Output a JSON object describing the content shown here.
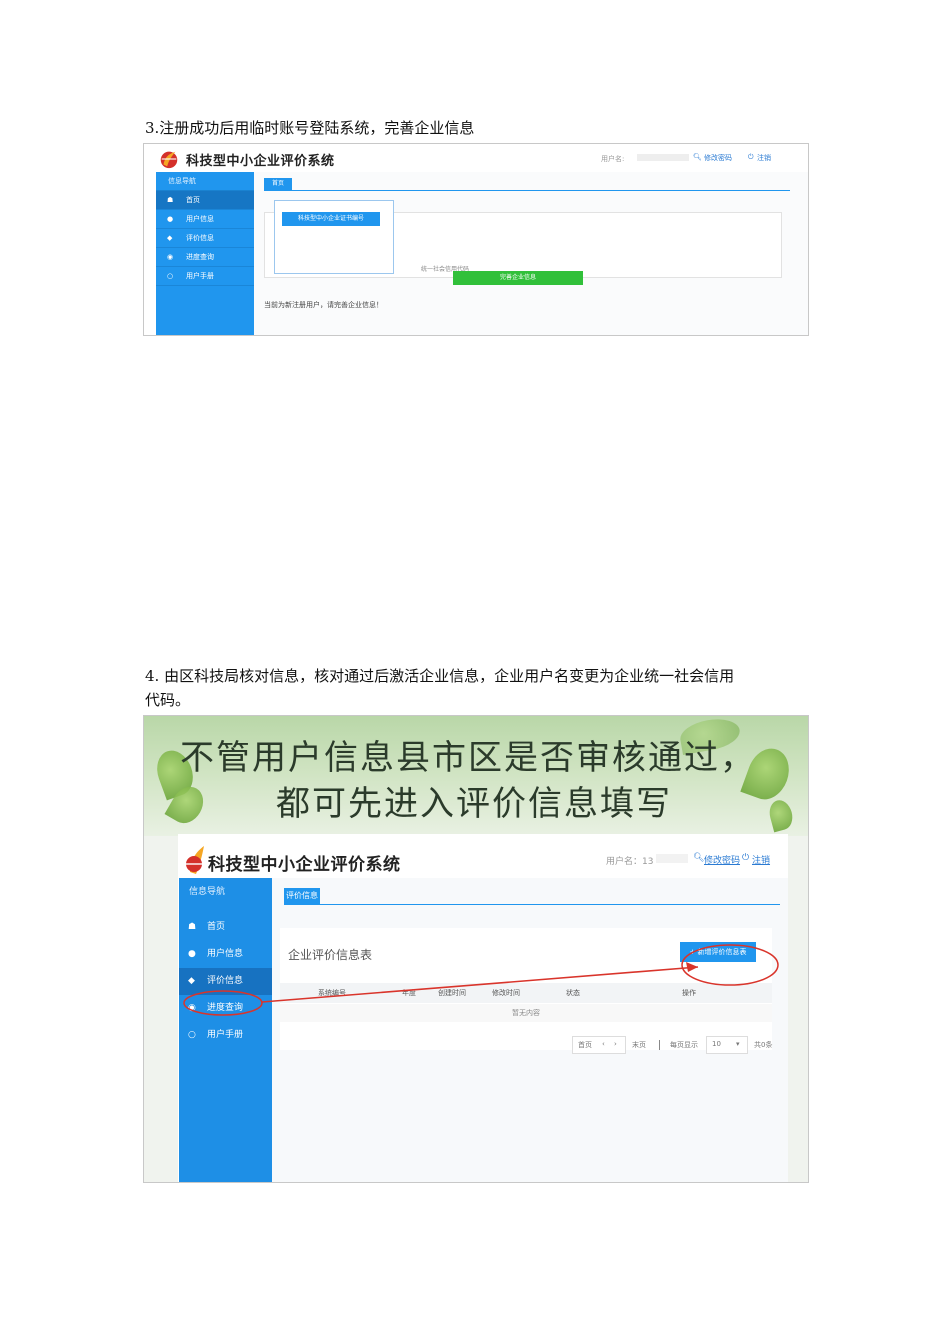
{
  "step3": {
    "text": "3.注册成功后用临时账号登陆系统，完善企业信息",
    "screenshot": {
      "brand": "科技型中小企业评价系统",
      "user_label": "用户名:",
      "link_password": "修改密码",
      "link_logout": "注销",
      "sidebar_title": "信息导航",
      "nav": [
        {
          "label": "首页",
          "icon": "home-icon"
        },
        {
          "label": "用户信息",
          "icon": "user-icon"
        },
        {
          "label": "评价信息",
          "icon": "tag-icon"
        },
        {
          "label": "进度查询",
          "icon": "eye-icon"
        },
        {
          "label": "用户手册",
          "icon": "help-icon"
        }
      ],
      "tab": "首页",
      "card_button": "科技型中小企业证书编号",
      "credit_code_label": "统一社会信用代码",
      "complete_button": "完善企业信息",
      "notice": "当前为新注册用户，请完善企业信息！"
    }
  },
  "step4": {
    "text": "4.  由区科技局核对信息，核对通过后激活企业信息，企业用户名变更为企业统一社会信用代码。",
    "text_line1": "4.  由区科技局核对信息，核对通过后激活企业信息，企业用户名变更为企业统一社会信用",
    "text_line2": "代码。",
    "screenshot": {
      "banner_line1": "不管用户信息县市区是否审核通过，",
      "banner_line2": "都可先进入评价信息填写",
      "brand": "科技型中小企业评价系统",
      "user_label": "用户名：13",
      "link_password": "修改密码",
      "link_logout": "注销",
      "sidebar_title": "信息导航",
      "nav": [
        {
          "label": "首页",
          "icon": "home-icon"
        },
        {
          "label": "用户信息",
          "icon": "user-icon"
        },
        {
          "label": "评价信息",
          "icon": "tag-icon"
        },
        {
          "label": "进度查询",
          "icon": "eye-icon"
        },
        {
          "label": "用户手册",
          "icon": "help-icon"
        }
      ],
      "tab": "评价信息",
      "table_title": "企业评价信息表",
      "add_button": "+ 新增评价信息表",
      "columns": [
        "系统编号",
        "年度",
        "创建时间",
        "修改时间",
        "状态",
        "操作"
      ],
      "empty_text": "暂无内容",
      "pager": {
        "first": "首页",
        "last": "末页",
        "per_page_label": "每页显示",
        "per_page": "10",
        "records": "共0条"
      },
      "annotation_color": "#d9342b"
    }
  }
}
